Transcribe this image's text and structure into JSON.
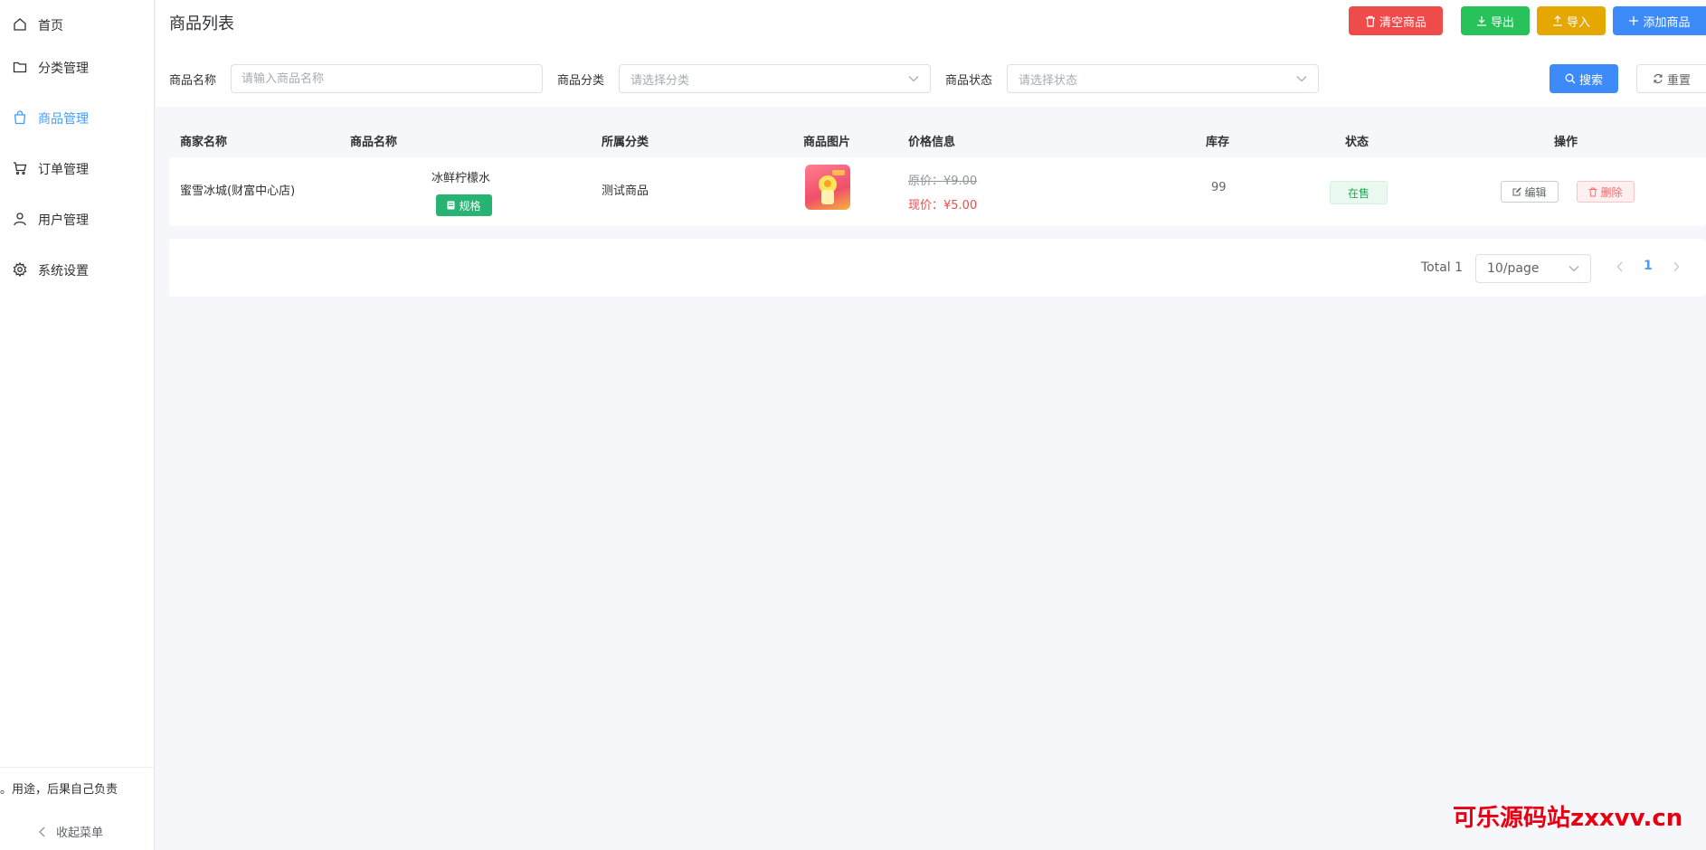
{
  "sidebar": {
    "items": [
      {
        "label": "首页",
        "icon": "home-icon"
      },
      {
        "label": "分类管理",
        "icon": "folder-icon"
      },
      {
        "label": "商品管理",
        "icon": "shopping-bag-icon",
        "active": true
      },
      {
        "label": "订单管理",
        "icon": "cart-icon"
      },
      {
        "label": "用户管理",
        "icon": "user-icon"
      },
      {
        "label": "系统设置",
        "icon": "gear-icon"
      }
    ],
    "notice": "用途，后果自己负责。",
    "collapse_label": "收起菜单"
  },
  "header": {
    "title": "商品列表",
    "buttons": {
      "clear": "清空商品",
      "export": "导出",
      "import": "导入",
      "add": "添加商品"
    }
  },
  "filters": {
    "name_label": "商品名称",
    "name_placeholder": "请输入商品名称",
    "category_label": "商品分类",
    "category_placeholder": "请选择分类",
    "status_label": "商品状态",
    "status_placeholder": "请选择状态",
    "search_label": "搜索",
    "reset_label": "重置"
  },
  "table": {
    "columns": [
      "商家名称",
      "商品名称",
      "所属分类",
      "商品图片",
      "价格信息",
      "库存",
      "状态",
      "操作"
    ],
    "rows": [
      {
        "merchant": "蜜雪冰城(财富中心店)",
        "product": "冰鲜柠檬水",
        "spec_label": "规格",
        "category": "测试商品",
        "original_price": "原价：¥9.00",
        "current_price": "现价：¥5.00",
        "stock": "99",
        "status": "在售",
        "edit_label": "编辑",
        "delete_label": "删除"
      }
    ]
  },
  "pagination": {
    "total": "Total 1",
    "page_size": "10/page",
    "current_page": "1"
  },
  "watermark": "可乐源码站zxxvv.cn",
  "colors": {
    "primary": "#3d8bf8",
    "danger": "#f04b4b",
    "success": "#27c35a",
    "warning": "#e6a700",
    "price_red": "#f04b4b"
  }
}
